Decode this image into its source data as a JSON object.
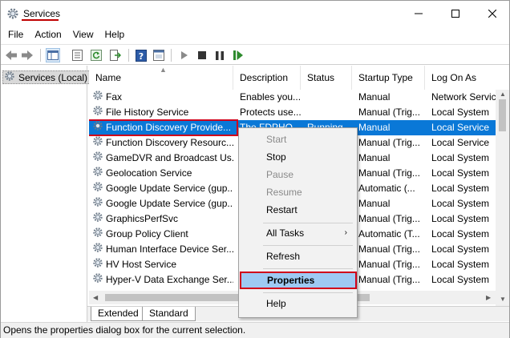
{
  "window": {
    "title": "Services"
  },
  "menu": [
    "File",
    "Action",
    "View",
    "Help"
  ],
  "tree": {
    "root_label": "Services (Local)"
  },
  "columns": {
    "name": "Name",
    "description": "Description",
    "status": "Status",
    "startup": "Startup Type",
    "logon": "Log On As"
  },
  "rows": [
    {
      "name": "Fax",
      "description": "Enables you...",
      "status": "",
      "startup": "Manual",
      "logon": "Network Service"
    },
    {
      "name": "File History Service",
      "description": "Protects use...",
      "status": "",
      "startup": "Manual (Trig...",
      "logon": "Local System"
    },
    {
      "name": "Function Discovery Provide...",
      "description": "The FDPHO...",
      "status": "Running",
      "startup": "Manual",
      "logon": "Local Service",
      "selected": true
    },
    {
      "name": "Function Discovery Resourc...",
      "description": "",
      "status": "",
      "startup": "Manual (Trig...",
      "logon": "Local Service"
    },
    {
      "name": "GameDVR and Broadcast Us...",
      "description": "",
      "status": "",
      "startup": "Manual",
      "logon": "Local System"
    },
    {
      "name": "Geolocation Service",
      "description": "",
      "status": "",
      "startup": "Manual (Trig...",
      "logon": "Local System"
    },
    {
      "name": "Google Update Service (gup...",
      "description": "",
      "status": "",
      "startup": "Automatic (...",
      "logon": "Local System"
    },
    {
      "name": "Google Update Service (gup...",
      "description": "",
      "status": "",
      "startup": "Manual",
      "logon": "Local System"
    },
    {
      "name": "GraphicsPerfSvc",
      "description": "",
      "status": "",
      "startup": "Manual (Trig...",
      "logon": "Local System"
    },
    {
      "name": "Group Policy Client",
      "description": "",
      "status": "",
      "startup": "Automatic (T...",
      "logon": "Local System"
    },
    {
      "name": "Human Interface Device Ser...",
      "description": "",
      "status": "",
      "startup": "Manual (Trig...",
      "logon": "Local System"
    },
    {
      "name": "HV Host Service",
      "description": "",
      "status": "",
      "startup": "Manual (Trig...",
      "logon": "Local System"
    },
    {
      "name": "Hyper-V Data Exchange Ser...",
      "description": "",
      "status": "",
      "startup": "Manual (Trig...",
      "logon": "Local System"
    }
  ],
  "context_menu": {
    "start": "Start",
    "stop": "Stop",
    "pause": "Pause",
    "resume": "Resume",
    "restart": "Restart",
    "all_tasks": "All Tasks",
    "refresh": "Refresh",
    "properties": "Properties",
    "help": "Help"
  },
  "tabs": {
    "extended": "Extended",
    "standard": "Standard"
  },
  "status_text": "Opens the properties dialog box for the current selection.",
  "colors": {
    "selection": "#0a78d7",
    "annotation_red": "#d0021b",
    "menu_highlight": "#9ecaf3"
  },
  "icons": [
    "services-gear-icon",
    "back-arrow-icon",
    "forward-arrow-icon",
    "console-tree-icon",
    "properties-sheet-icon",
    "refresh-icon",
    "export-list-icon",
    "help-icon",
    "mmc-icon",
    "play-icon",
    "stop-icon",
    "pause-icon",
    "resume-icon"
  ]
}
